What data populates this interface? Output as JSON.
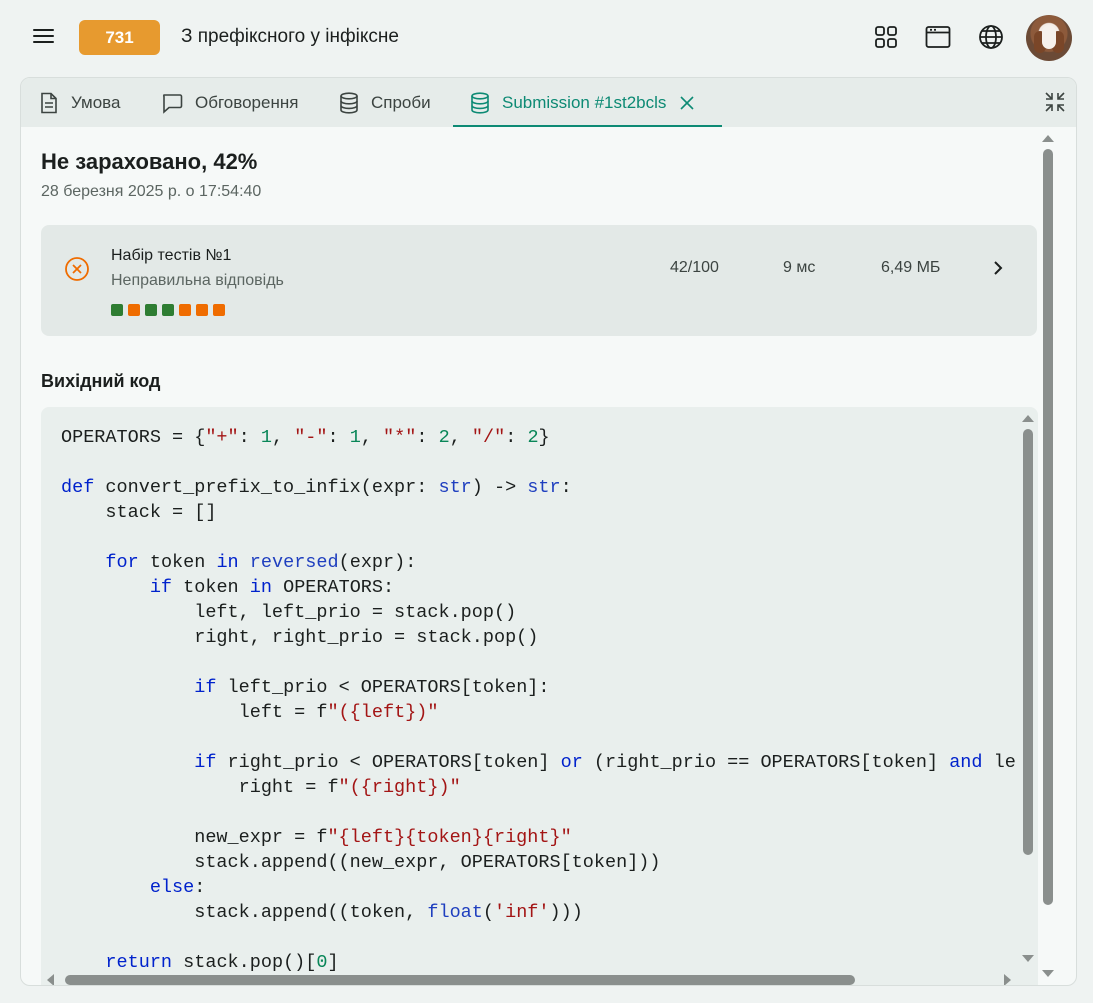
{
  "header": {
    "rating_badge": "731",
    "problem_title": "З префіксного у інфіксне",
    "icons": [
      "menu-icon",
      "grid-icon",
      "window-icon",
      "globe-icon",
      "avatar"
    ]
  },
  "tabs": [
    {
      "label": "Умова",
      "icon": "document-icon",
      "active": false
    },
    {
      "label": "Обговорення",
      "icon": "chat-icon",
      "active": false
    },
    {
      "label": "Спроби",
      "icon": "database-icon",
      "active": false
    },
    {
      "label": "Submission #1st2bcls",
      "icon": "database-icon",
      "active": true,
      "closable": true
    }
  ],
  "submission": {
    "status": "Не зараховано, 42%",
    "date": "28 березня 2025 р. о 17:54:40"
  },
  "test_group": {
    "name": "Набір тестів №1",
    "verdict": "Неправильна відповідь",
    "score": "42/100",
    "time": "9 мс",
    "memory": "6,49 МБ",
    "tests": [
      "passed",
      "failed",
      "passed",
      "passed",
      "failed",
      "failed",
      "failed"
    ]
  },
  "colors": {
    "accent": "#0d8a74",
    "badge": "#e79a2f",
    "passed": "#2e7d32",
    "failed": "#ef6c00",
    "fail_icon": "#ef6c00"
  },
  "source": {
    "heading": "Вихідний код",
    "lines": [
      "OPERATORS = {\"+\": 1, \"-\": 1, \"*\": 2, \"/\": 2}",
      "",
      "def convert_prefix_to_infix(expr: str) -> str:",
      "    stack = []",
      "",
      "    for token in reversed(expr):",
      "        if token in OPERATORS:",
      "            left, left_prio = stack.pop()",
      "            right, right_prio = stack.pop()",
      "",
      "            if left_prio < OPERATORS[token]:",
      "                left = f\"({left})\"",
      "",
      "            if right_prio < OPERATORS[token] or (right_prio == OPERATORS[token] and le",
      "                right = f\"({right})\"",
      "",
      "            new_expr = f\"{left}{token}{right}\"",
      "            stack.append((new_expr, OPERATORS[token]))",
      "        else:",
      "            stack.append((token, float('inf')))",
      "",
      "    return stack.pop()[0]"
    ]
  }
}
